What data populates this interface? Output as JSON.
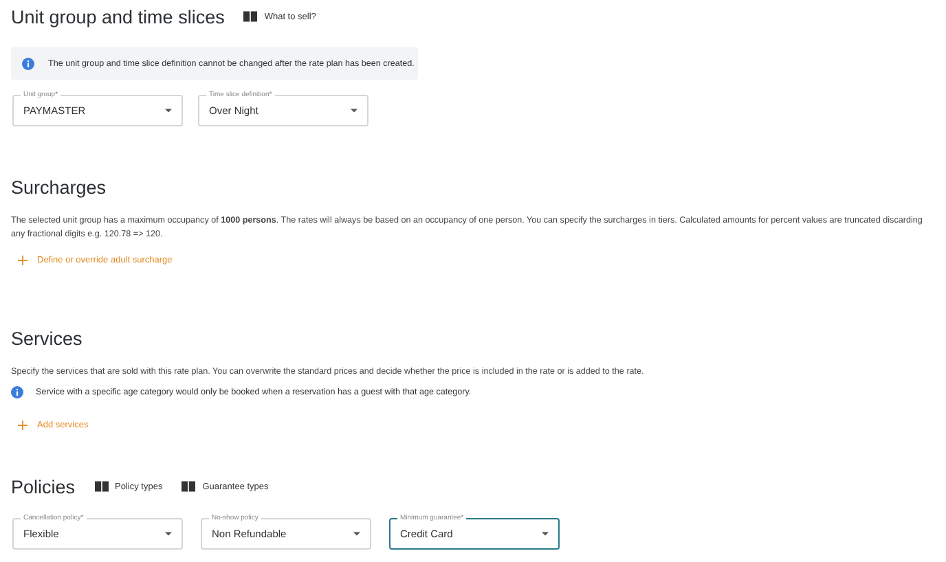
{
  "unit_section": {
    "title": "Unit group and time slices",
    "links": [
      {
        "label": "What to sell?"
      }
    ],
    "info": "The unit group and time slice definition cannot be changed after the rate plan has been created.",
    "fields": [
      {
        "label": "Unit group*",
        "value": "PAYMASTER",
        "focused": false
      },
      {
        "label": "Time slice definition*",
        "value": "Over Night",
        "focused": false
      }
    ]
  },
  "surcharges": {
    "title": "Surcharges",
    "text": "The selected unit group has a maximum occupancy of **1000 persons**. The rates will always be based on an occupancy of one person. You can specify the surcharges in tiers. Calculated amounts for percent values are truncated discarding any fractional digits e.g. 120.78 => 120.",
    "action": "Define or override adult surcharge"
  },
  "services": {
    "title": "Services",
    "text": "Specify the services that are sold with this rate plan. You can overwrite the standard prices and decide whether the price is included in the rate or is added to the rate.",
    "info": "Service with a specific age category would only be booked when a reservation has a guest with that age category.",
    "action": "Add services"
  },
  "policies": {
    "title": "Policies",
    "links": [
      {
        "label": "Policy types"
      },
      {
        "label": "Guarantee types"
      }
    ],
    "fields": [
      {
        "label": "Cancellation policy*",
        "value": "Flexible",
        "focused": false
      },
      {
        "label": "No-show policy",
        "value": "Non Refundable",
        "focused": false
      },
      {
        "label": "Minimum guarantee*",
        "value": "Credit Card",
        "focused": true
      }
    ]
  }
}
